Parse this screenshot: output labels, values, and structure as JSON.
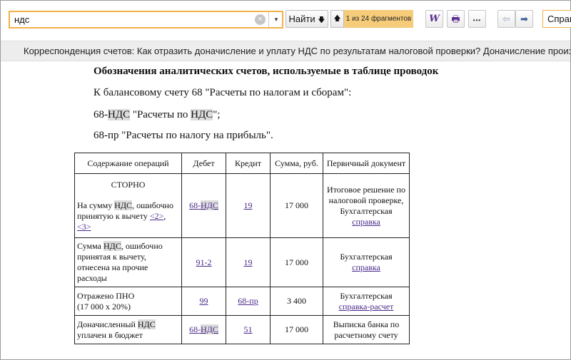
{
  "search": {
    "query": "ндс",
    "find_label": "Найти",
    "fragments": "1 из 24 фрагментов",
    "help_label": "Справ"
  },
  "icons": {
    "clear": "×",
    "dropdown": "▾",
    "find_arrow": "🡇",
    "up": "🡅",
    "word": "W",
    "print": "🖶",
    "more": "•••",
    "back": "⇦",
    "forward": "➡"
  },
  "breadcrumb": "Корреспонденция счетов: Как отразить доначисление и уплату НДС по результатам налоговой проверки? Доначисление производится",
  "document": {
    "heading": "Обозначения аналитических счетов, используемые в таблице проводок",
    "line1": "К балансовому счету 68 \"Расчеты по налогам и сборам\":",
    "line2": {
      "a": "68-",
      "b": "НДС",
      "c": " \"Расчеты по ",
      "d": "НДС",
      "e": "\";"
    },
    "line3": "68-пр \"Расчеты по налогу на прибыль\"."
  },
  "table": {
    "headers": [
      "Содержание операций",
      "Дебет",
      "Кредит",
      "Сумма, руб.",
      "Первичный документ"
    ],
    "rows": [
      {
        "storno": "СТОРНО",
        "op_a": "На сумму ",
        "op_hl": "НДС",
        "op_b": ", ошибочно принятую к вычету ",
        "ref1": "<2>",
        "ref_sep": ",",
        "ref2": "<3>",
        "debit_a": "68-",
        "debit_b": "НДС",
        "credit": "19",
        "amount": "17 000",
        "doc_text": "Итоговое решение по налоговой проверке, Бухгалтерская",
        "doc_link": "справка"
      },
      {
        "op_a": "Сумма ",
        "op_hl": "НДС",
        "op_b": ", ошибочно принятая к вычету, отнесена на прочие расходы",
        "debit": "91-2",
        "credit": "19",
        "amount": "17 000",
        "doc_text": "Бухгалтерская",
        "doc_link": "справка"
      },
      {
        "op_a": "Отражено ПНО",
        "op_b": "(17 000 х 20%)",
        "debit": "99",
        "credit": "68-пр",
        "amount": "3 400",
        "doc_text": "Бухгалтерская",
        "doc_link": "справка-расчет"
      },
      {
        "op_a": "Доначисленный ",
        "op_hl": "НДС",
        "op_b": " уплачен в бюджет",
        "debit_a": "68-",
        "debit_b": "НДС",
        "credit": "51",
        "amount": "17 000",
        "doc_text": "Выписка банка по расчетному счету"
      }
    ]
  }
}
